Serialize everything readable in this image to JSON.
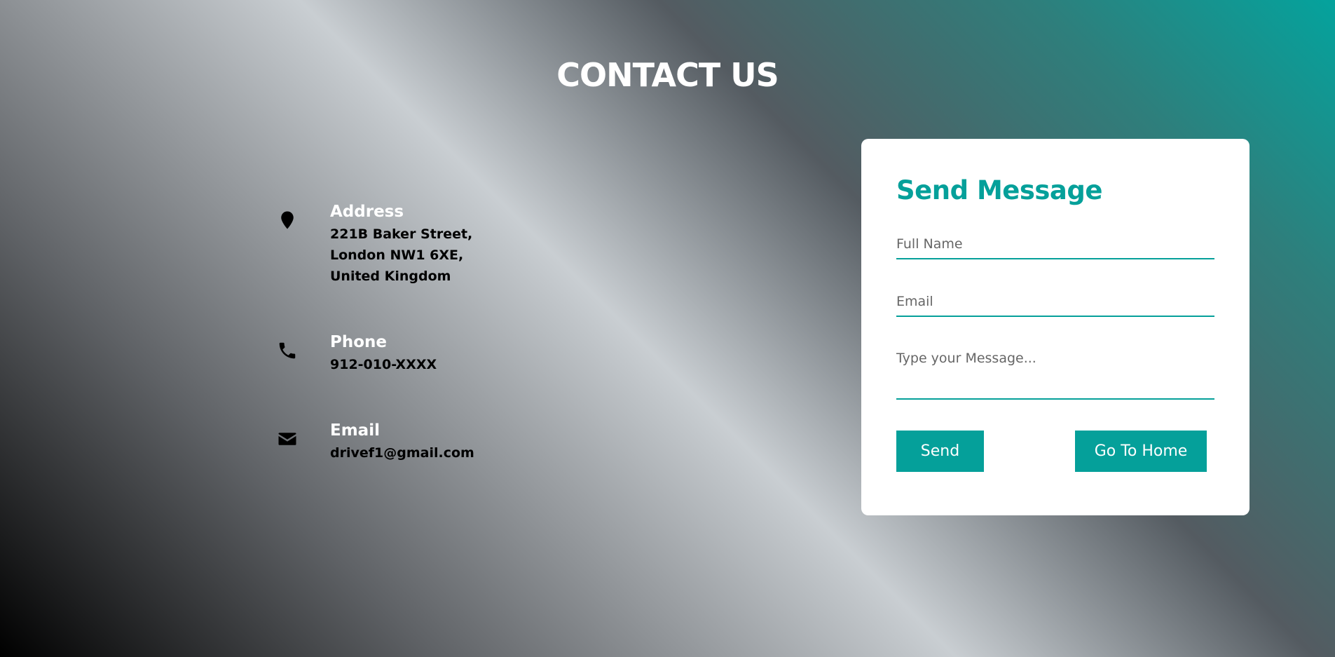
{
  "page": {
    "title": "CONTACT US"
  },
  "contact_info": [
    {
      "icon": "map-pin-icon",
      "heading": "Address",
      "value": "221B Baker Street,\nLondon NW1 6XE,\nUnited Kingdom"
    },
    {
      "icon": "phone-icon",
      "heading": "Phone",
      "value": "912-010-XXXX"
    },
    {
      "icon": "envelope-icon",
      "heading": "Email",
      "value": "drivef1@gmail.com"
    }
  ],
  "form": {
    "title": "Send Message",
    "full_name_placeholder": "Full Name",
    "email_placeholder": "Email",
    "message_placeholder": "Type your Message...",
    "send_label": "Send",
    "home_label": "Go To Home"
  },
  "colors": {
    "accent": "#05a09a",
    "card_background": "#ffffff"
  }
}
